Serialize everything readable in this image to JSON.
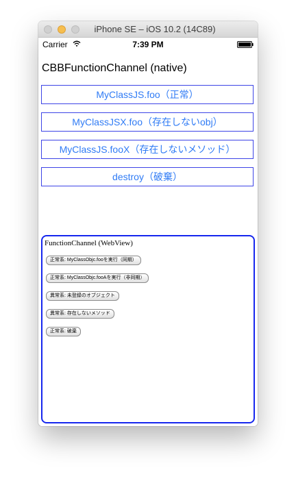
{
  "window": {
    "title": "iPhone SE – iOS 10.2 (14C89)"
  },
  "status_bar": {
    "carrier": "Carrier",
    "time": "7:39 PM",
    "icons": [
      "wifi-icon",
      "battery-icon"
    ]
  },
  "page": {
    "title": "CBBFunctionChannel (native)"
  },
  "native_buttons": [
    "MyClassJS.foo（正常）",
    "MyClassJSX.foo（存在しないobj）",
    "MyClassJS.fooX（存在しないメソッド）",
    "destroy（破棄）"
  ],
  "webview": {
    "title": "FunctionChannel (WebView)",
    "buttons": [
      "正常系: MyClassObjc.fooを実行（同期）",
      "正常系: MyClassObjc.fooAを実行（非同期）",
      "異常系: 未登録のオブジェクト",
      "異常系: 存在しないメソッド",
      "正常系: 破棄"
    ]
  },
  "colors": {
    "button_border": "#3c43e6",
    "button_text": "#2f7bf5",
    "webview_border": "#1526ee"
  }
}
